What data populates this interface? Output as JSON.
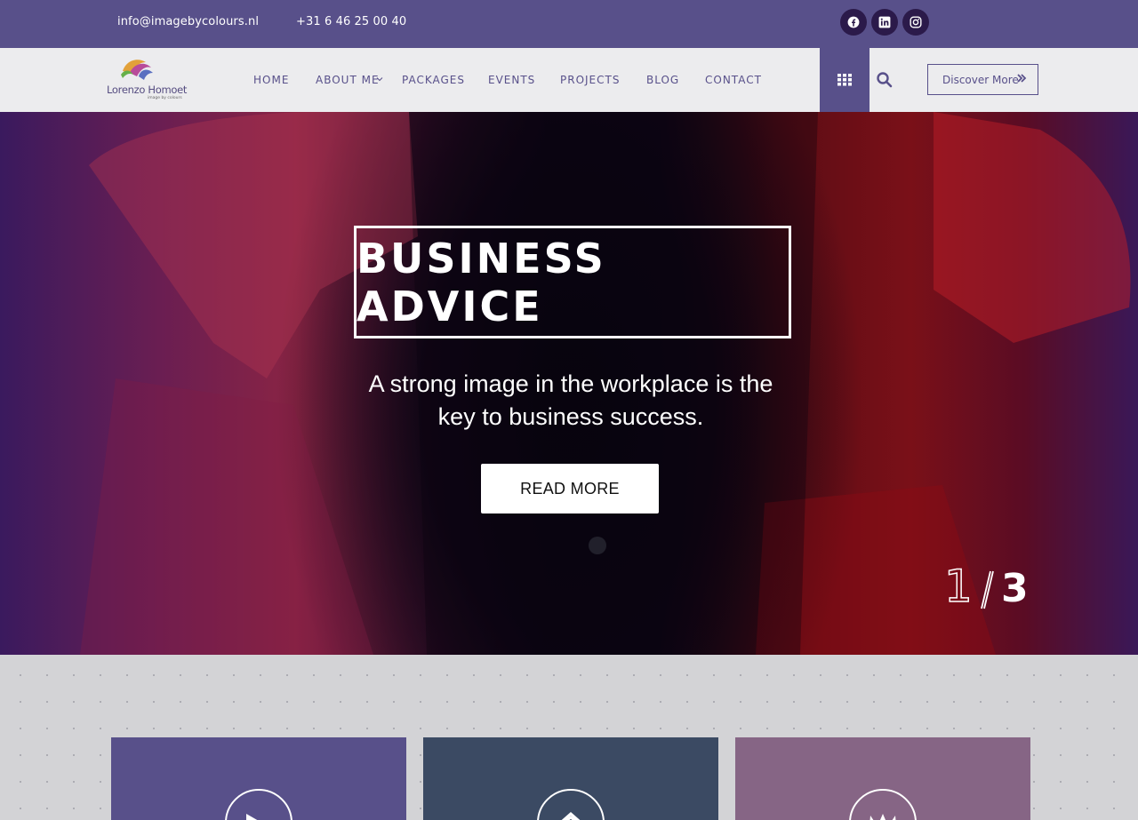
{
  "topbar": {
    "email": "info@imagebycolours.nl",
    "phone": "+31 6 46 25 00 40",
    "social": [
      {
        "icon": "facebook-icon"
      },
      {
        "icon": "linkedin-icon"
      },
      {
        "icon": "instagram-icon"
      }
    ]
  },
  "brand": {
    "name": "Lorenzo Homoet",
    "tagline": "image by colours"
  },
  "nav": {
    "items": [
      {
        "label": "HOME"
      },
      {
        "label": "ABOUT ME"
      },
      {
        "label": "PACKAGES"
      },
      {
        "label": "EVENTS"
      },
      {
        "label": "PROJECTS"
      },
      {
        "label": "BLOG"
      },
      {
        "label": "CONTACT"
      }
    ],
    "discover_label": "Discover More"
  },
  "hero": {
    "title": "BUSINESS ADVICE",
    "subtitle_line1": "A strong image in the workplace is the",
    "subtitle_line2": "key to business success.",
    "button_label": "READ MORE",
    "slide_current": "1",
    "slide_total": "3"
  },
  "colors": {
    "brand_purple": "#58508a",
    "card_1": "#58508a",
    "card_2": "#3b4a63",
    "card_3": "#866585"
  },
  "cards": [
    {
      "icon": "play-icon"
    },
    {
      "icon": "home-icon"
    },
    {
      "icon": "crown-icon"
    }
  ]
}
